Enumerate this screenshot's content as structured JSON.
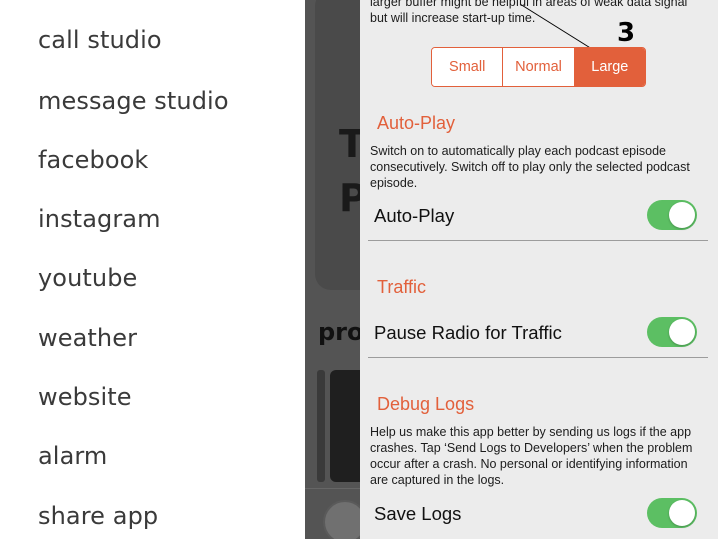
{
  "menu": {
    "items": [
      {
        "label": "call studio"
      },
      {
        "label": "message studio"
      },
      {
        "label": "facebook"
      },
      {
        "label": "instagram"
      },
      {
        "label": "youtube"
      },
      {
        "label": "weather"
      },
      {
        "label": "website"
      },
      {
        "label": "alarm"
      },
      {
        "label": "share app"
      }
    ]
  },
  "background": {
    "letter_1": "T",
    "letter_2": "P",
    "section_fragment": "pro"
  },
  "settings": {
    "buffer": {
      "description": "larger buffer might be helpful in areas of weak data signal but will increase start-up time.",
      "options": [
        "Small",
        "Normal",
        "Large"
      ],
      "selected": "Large",
      "annotation": "3"
    },
    "autoplay": {
      "title": "Auto-Play",
      "description": "Switch on to automatically play each podcast episode consecutively. Switch off to play only the selected podcast episode.",
      "label": "Auto-Play",
      "enabled": true
    },
    "traffic": {
      "title": "Traffic",
      "label": "Pause Radio for Traffic",
      "enabled": true
    },
    "debug": {
      "title": "Debug Logs",
      "description": "Help us make this app better by sending us logs if the app crashes. Tap ‘Send Logs to Developers’ when the problem occur after a crash. No personal or identifying information are captured in the logs.",
      "label": "Save Logs",
      "enabled": true
    }
  },
  "colors": {
    "accent": "#e2603b",
    "toggle_on": "#5cbf63",
    "panel_bg": "#ececec",
    "overlay": "#545454"
  }
}
